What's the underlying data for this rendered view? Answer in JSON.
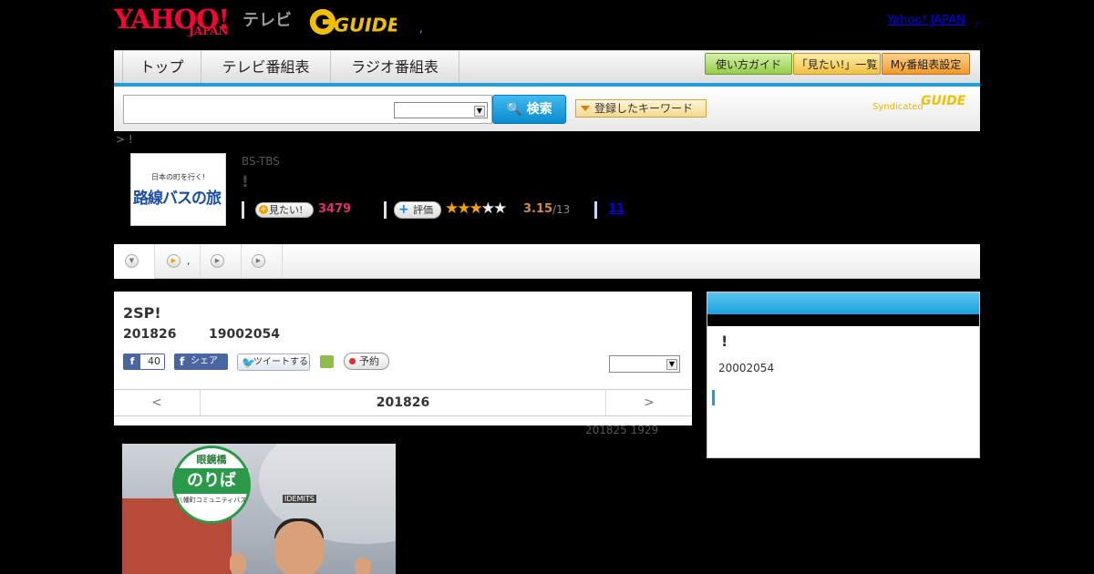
{
  "header": {
    "logo_yahoo": "YAHOO!",
    "logo_japan": "JAPAN",
    "logo_tv": "テレビ",
    "logo_gguide": "GUIDE",
    "dot": ",",
    "yahoo_japan_link": "Yahoo! JAPAN",
    "yahoo_japan_dot": ","
  },
  "nav": {
    "tabs": [
      "トップ",
      "テレビ番組表",
      "ラジオ番組表"
    ],
    "buttons": [
      "使い方ガイド",
      "「見たい!」一覧",
      "My番組表設定"
    ],
    "accent": "#1aa0e0"
  },
  "search": {
    "input_value": "",
    "select_value": "",
    "search_button": "検索",
    "keyword_button": "登録したキーワード",
    "syndicated": "Syndicated",
    "syndicated_logo": "GUIDE"
  },
  "breadcrumb": "> !",
  "program": {
    "thumb_top": "日本の町を行く!",
    "thumb_title": "路線バスの旅",
    "station": "BS-TBS",
    "title": "!",
    "mitai_label": "見たい!",
    "mitai_count": "3479",
    "hyoka_label": "評価",
    "stars_on": 3,
    "stars_total": 5,
    "rating": "3.15",
    "rating_count": "/13",
    "review_link": "11"
  },
  "subtabs": [
    ",",
    "",
    ""
  ],
  "main": {
    "title": "2SP!",
    "date": "201826",
    "time": "19002054",
    "fb_like_count": "40",
    "fb_share_label": "シェア",
    "tweet_label": "ツイートする",
    "yoyaku_label": "予約",
    "select_value": "",
    "prev": "<",
    "current_date": "201826",
    "next": ">",
    "updated": "201825  1929"
  },
  "photo": {
    "sign_top": "眼鏡橋",
    "sign_main": "のりば",
    "sign_bottom": "八幡町コミュニティバス",
    "sign_label": "IDEMITS"
  },
  "right_panel": {
    "title": "!",
    "date": "20002054"
  }
}
